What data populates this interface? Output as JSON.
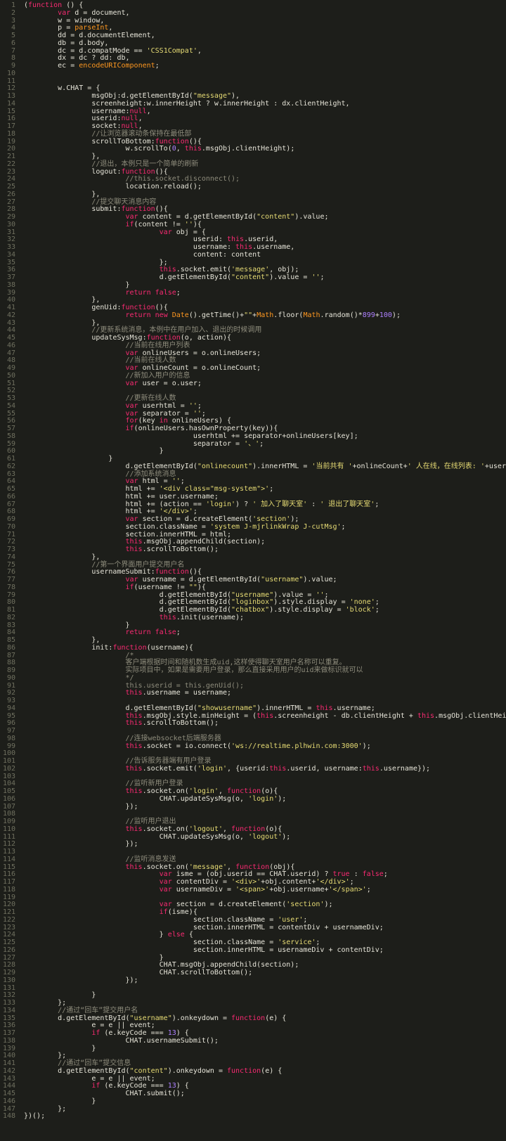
{
  "colors": {
    "background": "#1d1e1a",
    "gutter": "#6f705f",
    "plain": "#e6e4d8",
    "keyword": "#f92a72",
    "string": "#e6db74",
    "number": "#ae81ff",
    "function": "#fd9720",
    "comment": "#8e8c7c",
    "this": "#f92a72"
  },
  "editor": {
    "lines": [
      "(function () {",
      "        var d = document,",
      "        w = window,",
      "        p = parseInt,",
      "        dd = d.documentElement,",
      "        db = d.body,",
      "        dc = d.compatMode == 'CSS1Compat',",
      "        dx = dc ? dd: db,",
      "        ec = encodeURIComponent;",
      "",
      "",
      "        w.CHAT = {",
      "                msgObj:d.getElementById(\"message\"),",
      "                screenheight:w.innerHeight ? w.innerHeight : dx.clientHeight,",
      "                username:null,",
      "                userid:null,",
      "                socket:null,",
      "                //让浏览器滚动条保持在最低部",
      "                scrollToBottom:function(){",
      "                        w.scrollTo(0, this.msgObj.clientHeight);",
      "                },",
      "                //退出，本例只是一个简单的刷新",
      "                logout:function(){",
      "                        //this.socket.disconnect();",
      "                        location.reload();",
      "                },",
      "                //提交聊天消息内容",
      "                submit:function(){",
      "                        var content = d.getElementById(\"content\").value;",
      "                        if(content != ''){",
      "                                var obj = {",
      "                                        userid: this.userid,",
      "                                        username: this.username,",
      "                                        content: content",
      "                                };",
      "                                this.socket.emit('message', obj);",
      "                                d.getElementById(\"content\").value = '';",
      "                        }",
      "                        return false;",
      "                },",
      "                genUid:function(){",
      "                        return new Date().getTime()+\"\"+Math.floor(Math.random()*899+100);",
      "                },",
      "                //更新系统消息，本例中在用户加入、退出的时候调用",
      "                updateSysMsg:function(o, action){",
      "                        //当前在线用户列表",
      "                        var onlineUsers = o.onlineUsers;",
      "                        //当前在线人数",
      "                        var onlineCount = o.onlineCount;",
      "                        //新加入用户的信息",
      "                        var user = o.user;",
      "",
      "                        //更新在线人数",
      "                        var userhtml = '';",
      "                        var separator = '';",
      "                        for(key in onlineUsers) {",
      "                        if(onlineUsers.hasOwnProperty(key)){",
      "                                        userhtml += separator+onlineUsers[key];",
      "                                        separator = '、';",
      "                                }",
      "                    }",
      "                        d.getElementById(\"onlinecount\").innerHTML = '当前共有 '+onlineCount+' 人在线，在线列表: '+userhtml;",
      "                        //添加系统消息",
      "                        var html = '';",
      "                        html += '<div class=\"msg-system\">';",
      "                        html += user.username;",
      "                        html += (action == 'login') ? ' 加入了聊天室' : ' 退出了聊天室';",
      "                        html += '</div>';",
      "                        var section = d.createElement('section');",
      "                        section.className = 'system J-mjrlinkWrap J-cutMsg';",
      "                        section.innerHTML = html;",
      "                        this.msgObj.appendChild(section);",
      "                        this.scrollToBottom();",
      "                },",
      "                //第一个界面用户提交用户名",
      "                usernameSubmit:function(){",
      "                        var username = d.getElementById(\"username\").value;",
      "                        if(username != \"\"){",
      "                                d.getElementById(\"username\").value = '';",
      "                                d.getElementById(\"loginbox\").style.display = 'none';",
      "                                d.getElementById(\"chatbox\").style.display = 'block';",
      "                                this.init(username);",
      "                        }",
      "                        return false;",
      "                },",
      "                init:function(username){",
      "                        /*",
      "                        客户端根据时间和随机数生成uid,这样使得聊天室用户名称可以重复。",
      "                        实际项目中，如果是需要用户登录，那么直接采用用户的uid来做标识就可以",
      "                        */",
      "                        this.userid = this.genUid();",
      "                        this.username = username;",
      "",
      "                        d.getElementById(\"showusername\").innerHTML = this.username;",
      "                        this.msgObj.style.minHeight = (this.screenheight - db.clientHeight + this.msgObj.clientHeight) + \"px\";",
      "                        this.scrollToBottom();",
      "",
      "                        //连接websocket后端服务器",
      "                        this.socket = io.connect('ws://realtime.plhwin.com:3000');",
      "",
      "                        //告诉服务器端有用户登录",
      "                        this.socket.emit('login', {userid:this.userid, username:this.username});",
      "",
      "                        //监听新用户登录",
      "                        this.socket.on('login', function(o){",
      "                                CHAT.updateSysMsg(o, 'login');",
      "                        });",
      "",
      "                        //监听用户退出",
      "                        this.socket.on('logout', function(o){",
      "                                CHAT.updateSysMsg(o, 'logout');",
      "                        });",
      "",
      "                        //监听消息发送",
      "                        this.socket.on('message', function(obj){",
      "                                var isme = (obj.userid == CHAT.userid) ? true : false;",
      "                                var contentDiv = '<div>'+obj.content+'</div>';",
      "                                var usernameDiv = '<span>'+obj.username+'</span>';",
      "",
      "                                var section = d.createElement('section');",
      "                                if(isme){",
      "                                        section.className = 'user';",
      "                                        section.innerHTML = contentDiv + usernameDiv;",
      "                                } else {",
      "                                        section.className = 'service';",
      "                                        section.innerHTML = usernameDiv + contentDiv;",
      "                                }",
      "                                CHAT.msgObj.appendChild(section);",
      "                                CHAT.scrollToBottom();",
      "                        });",
      "",
      "                }",
      "        };",
      "        //通过“回车”提交用户名",
      "        d.getElementById(\"username\").onkeydown = function(e) {",
      "                e = e || event;",
      "                if (e.keyCode === 13) {",
      "                        CHAT.usernameSubmit();",
      "                }",
      "        };",
      "        //通过“回车”提交信息",
      "        d.getElementById(\"content\").onkeydown = function(e) {",
      "                e = e || event;",
      "                if (e.keyCode === 13) {",
      "                        CHAT.submit();",
      "                }",
      "        };",
      "})();"
    ]
  }
}
